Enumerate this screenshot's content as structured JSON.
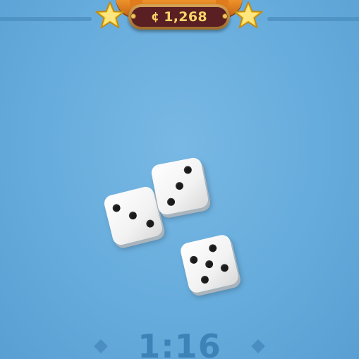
{
  "header": {
    "coin_symbol": "¢",
    "coin_amount": "1,268",
    "star_icon": "star-icon",
    "colors": {
      "background": "#6aaedc",
      "coin_text": "#f7d56a",
      "coin_pill": "#5a1f22",
      "banner": "#e07c1c",
      "star": "#f6d743"
    }
  },
  "dice": [
    {
      "name": "die-three",
      "value": 3
    },
    {
      "name": "die-three",
      "value": 3
    },
    {
      "name": "die-five",
      "value": 5
    }
  ],
  "timer": {
    "text": "1:16"
  }
}
